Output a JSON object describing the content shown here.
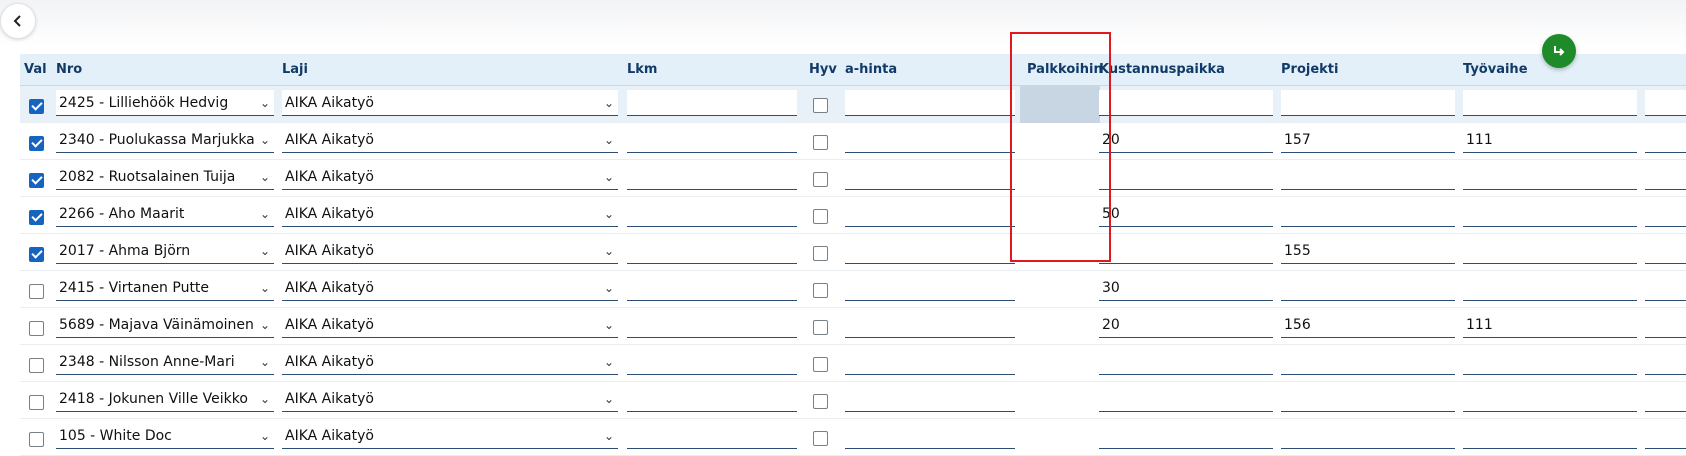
{
  "header": {
    "val": "Val",
    "nro": "Nro",
    "laji": "Laji",
    "lkm": "Lkm",
    "hyv": "Hyv",
    "ahinta": "a-hinta",
    "palkkoihin": "Palkkoihin",
    "kustannuspaikka": "Kustannuspaikka",
    "projekti": "Projekti",
    "tyovaihe": "Työvaihe"
  },
  "icons": {
    "back": "chevron-left-icon",
    "fab": "redo-arrow-icon",
    "select": "chevron-down-icon"
  },
  "colors": {
    "accent": "#1565c0",
    "fab": "#1e8a2a",
    "highlight": "#e0191e",
    "header_bg": "#e3f0fa"
  },
  "rows": [
    {
      "checked": true,
      "nro": "2425 - Lilliehöök Hedvig",
      "laji": "AIKA Aikatyö",
      "lkm": "",
      "ahinta": "",
      "kustannuspaikka": "",
      "projekti": "",
      "tyovaihe": ""
    },
    {
      "checked": true,
      "nro": "2340 - Puolukassa Marjukka",
      "laji": "AIKA Aikatyö",
      "lkm": "",
      "ahinta": "",
      "kustannuspaikka": "20",
      "projekti": "157",
      "tyovaihe": "111"
    },
    {
      "checked": true,
      "nro": "2082 - Ruotsalainen Tuija",
      "laji": "AIKA Aikatyö",
      "lkm": "",
      "ahinta": "",
      "kustannuspaikka": "",
      "projekti": "",
      "tyovaihe": ""
    },
    {
      "checked": true,
      "nro": "2266 - Aho Maarit",
      "laji": "AIKA Aikatyö",
      "lkm": "",
      "ahinta": "",
      "kustannuspaikka": "50",
      "projekti": "",
      "tyovaihe": ""
    },
    {
      "checked": true,
      "nro": "2017 - Ahma Björn",
      "laji": "AIKA Aikatyö",
      "lkm": "",
      "ahinta": "",
      "kustannuspaikka": "",
      "projekti": "155",
      "tyovaihe": ""
    },
    {
      "checked": false,
      "nro": "2415 - Virtanen Putte",
      "laji": "AIKA Aikatyö",
      "lkm": "",
      "ahinta": "",
      "kustannuspaikka": "30",
      "projekti": "",
      "tyovaihe": ""
    },
    {
      "checked": false,
      "nro": "5689 - Majava Väinämoinen",
      "laji": "AIKA Aikatyö",
      "lkm": "",
      "ahinta": "",
      "kustannuspaikka": "20",
      "projekti": "156",
      "tyovaihe": "111"
    },
    {
      "checked": false,
      "nro": "2348 - Nilsson Anne-Mari",
      "laji": "AIKA Aikatyö",
      "lkm": "",
      "ahinta": "",
      "kustannuspaikka": "",
      "projekti": "",
      "tyovaihe": ""
    },
    {
      "checked": false,
      "nro": "2418 - Jokunen Ville Veikko",
      "laji": "AIKA Aikatyö",
      "lkm": "",
      "ahinta": "",
      "kustannuspaikka": "",
      "projekti": "",
      "tyovaihe": ""
    },
    {
      "checked": false,
      "nro": "105 - White Doc",
      "laji": "AIKA Aikatyö",
      "lkm": "",
      "ahinta": "",
      "kustannuspaikka": "",
      "projekti": "",
      "tyovaihe": ""
    }
  ]
}
